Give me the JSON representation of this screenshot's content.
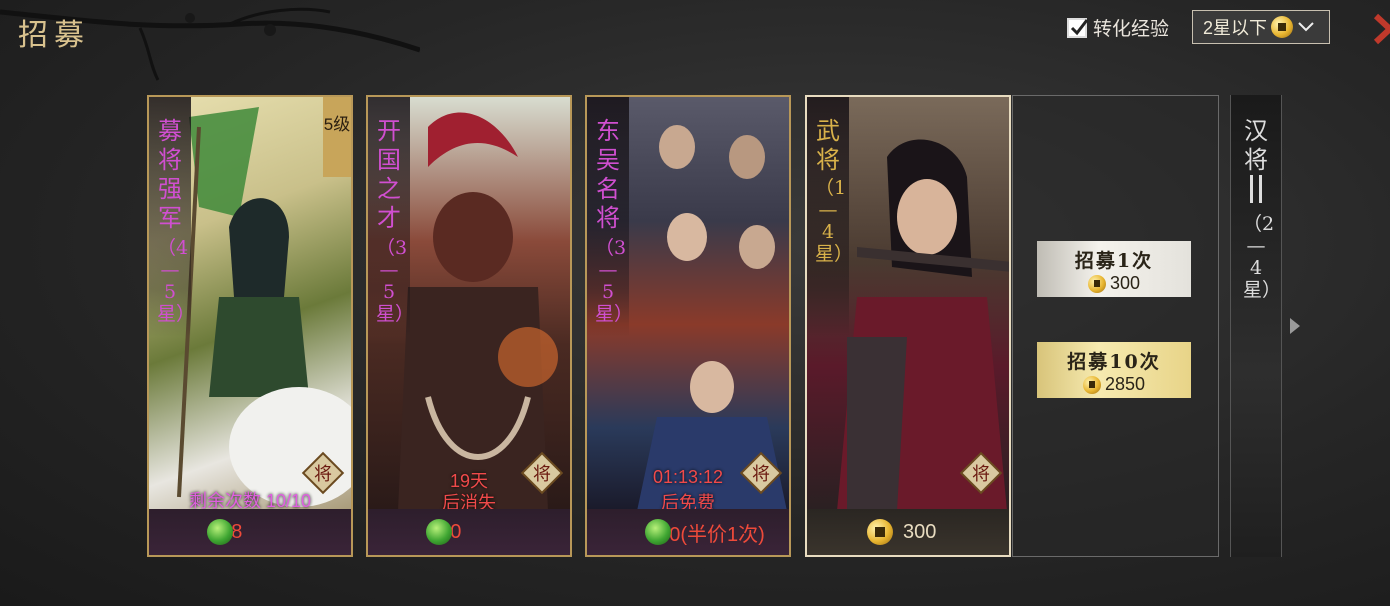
{
  "header": {
    "title": "招募"
  },
  "options": {
    "convert_label": "转化经验",
    "convert_checked": true,
    "filter_value": "2星以下"
  },
  "cards": [
    {
      "title": "募将强军",
      "range": "（4—5星）",
      "level": "5级",
      "status": "剩余次数 10/10",
      "currency": "jade",
      "price": "398",
      "badge": "将"
    },
    {
      "title": "开国之才",
      "range": "（3—5星）",
      "status_line1": "19天",
      "status_line2": "后消失",
      "currency": "jade",
      "price": "200",
      "badge": "将"
    },
    {
      "title": "东吴名将",
      "range": "（3—5星）",
      "status_line1": "01:13:12",
      "status_line2": "后免费",
      "currency": "jade",
      "price": "100(半价1次)",
      "badge": "将"
    },
    {
      "title": "武将",
      "range": "（1—4星）",
      "currency": "coin",
      "price": "300",
      "badge": "将"
    }
  ],
  "recruit_buttons": [
    {
      "label": "招募1次",
      "price": "300"
    },
    {
      "label": "招募10次",
      "price": "2850"
    }
  ],
  "next_card": {
    "title": "汉将",
    "range": "（2—4星）"
  },
  "colors": {
    "gold_border": "#b89858",
    "price_red": "#ee4a3a",
    "title_magenta": "#d04fd0",
    "title_gold": "#d9b24a"
  }
}
